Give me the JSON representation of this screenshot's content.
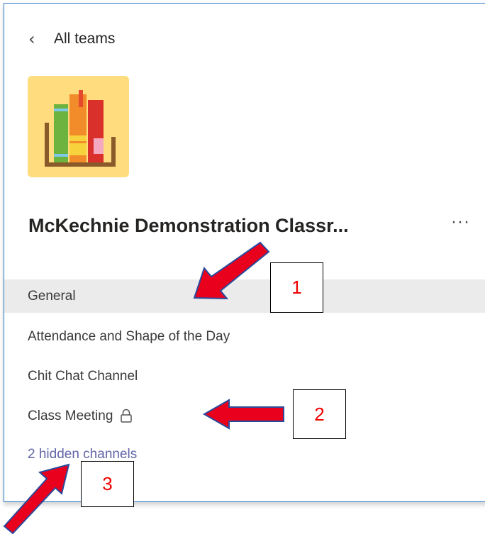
{
  "nav": {
    "back_label": "All teams"
  },
  "team": {
    "name": "McKechnie Demonstration Classr...",
    "more_label": "···",
    "tile_color": "#ffdc7e"
  },
  "channels": [
    {
      "label": "General",
      "selected": true
    },
    {
      "label": "Attendance and Shape of the Day",
      "selected": false
    },
    {
      "label": "Chit Chat Channel",
      "selected": false
    },
    {
      "label": "Class Meeting",
      "selected": false,
      "icon": "lock-icon"
    }
  ],
  "hidden_channels_link": "2 hidden channels",
  "annotations": [
    {
      "label": "1"
    },
    {
      "label": "2"
    },
    {
      "label": "3"
    }
  ],
  "colors": {
    "accent": "#6264a7",
    "selected_row": "#ebebeb",
    "annotation_arrow": "#e8001c",
    "annotation_outline": "#2b4a9c"
  }
}
